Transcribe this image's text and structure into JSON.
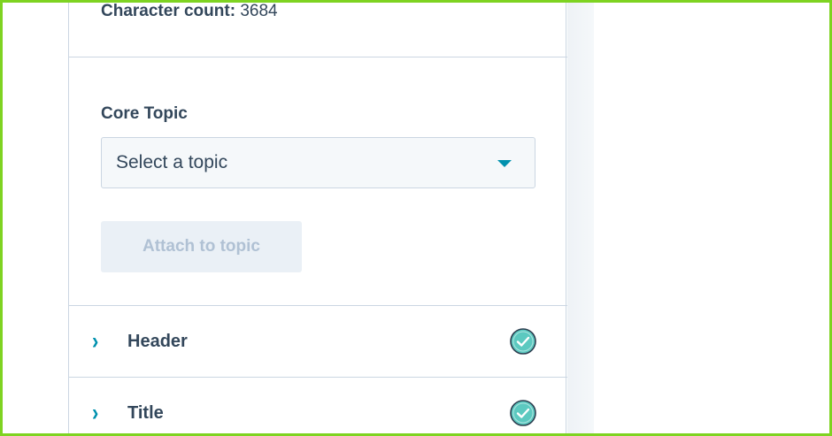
{
  "panel": {
    "character_count_label": "Character count:",
    "character_count_value": "3684"
  },
  "core_topic": {
    "label": "Core Topic",
    "selected_value": "Select a topic",
    "attach_button_label": "Attach to topic",
    "attach_button_enabled": false
  },
  "sections": [
    {
      "label": "Header",
      "status": "complete",
      "icon": "check-circle-icon"
    },
    {
      "label": "Title",
      "status": "complete",
      "icon": "check-circle-icon"
    }
  ],
  "colors": {
    "accent": "#0091ae",
    "text": "#33475b",
    "check_fill": "#5cc9c0",
    "frame": "#7ed321"
  }
}
